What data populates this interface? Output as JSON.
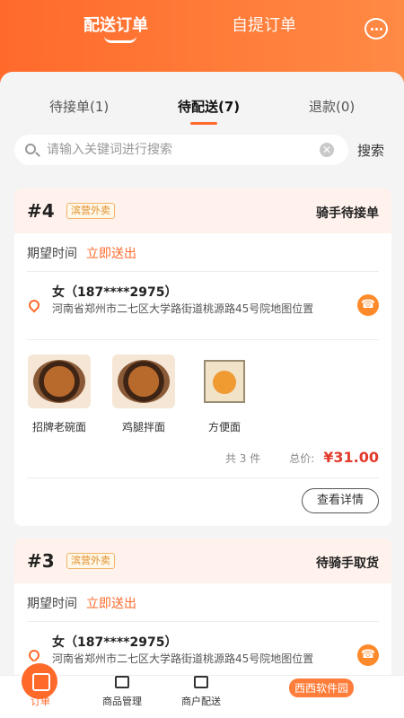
{
  "header": {
    "tabs": [
      {
        "label": "配送订单",
        "active": true
      },
      {
        "label": "自提订单",
        "active": false
      }
    ],
    "message_icon": "chat-icon"
  },
  "status_tabs": [
    {
      "label": "待接单(1)",
      "active": false
    },
    {
      "label": "待配送(7)",
      "active": true
    },
    {
      "label": "退款(0)",
      "active": false
    }
  ],
  "search": {
    "placeholder": "请输入关键词进行搜索",
    "button": "搜索"
  },
  "orders": [
    {
      "number": "#4",
      "tag": "滨营外卖",
      "status": "骑手待接单",
      "time_label": "期望时间",
      "time_value": "立即送出",
      "customer": "女（187****2975）",
      "address": "河南省郑州市二七区大学路街道桃源路45号院地图位置",
      "items": [
        {
          "name": "招牌老碗面"
        },
        {
          "name": "鸡腿拌面"
        },
        {
          "name": "方便面"
        }
      ],
      "count_text": "共 3 件",
      "total_label": "总价:",
      "total": "¥31.00",
      "detail_button": "查看详情"
    },
    {
      "number": "#3",
      "tag": "滨营外卖",
      "status": "待骑手取货",
      "time_label": "期望时间",
      "time_value": "立即送出",
      "customer": "女（187****2975）",
      "address": "河南省郑州市二七区大学路街道桃源路45号院地图位置"
    }
  ],
  "bottom_nav": [
    {
      "label": "订单",
      "active": true
    },
    {
      "label": "商品管理",
      "active": false
    },
    {
      "label": "商户配送",
      "active": false
    }
  ],
  "watermark": "西西软件园"
}
